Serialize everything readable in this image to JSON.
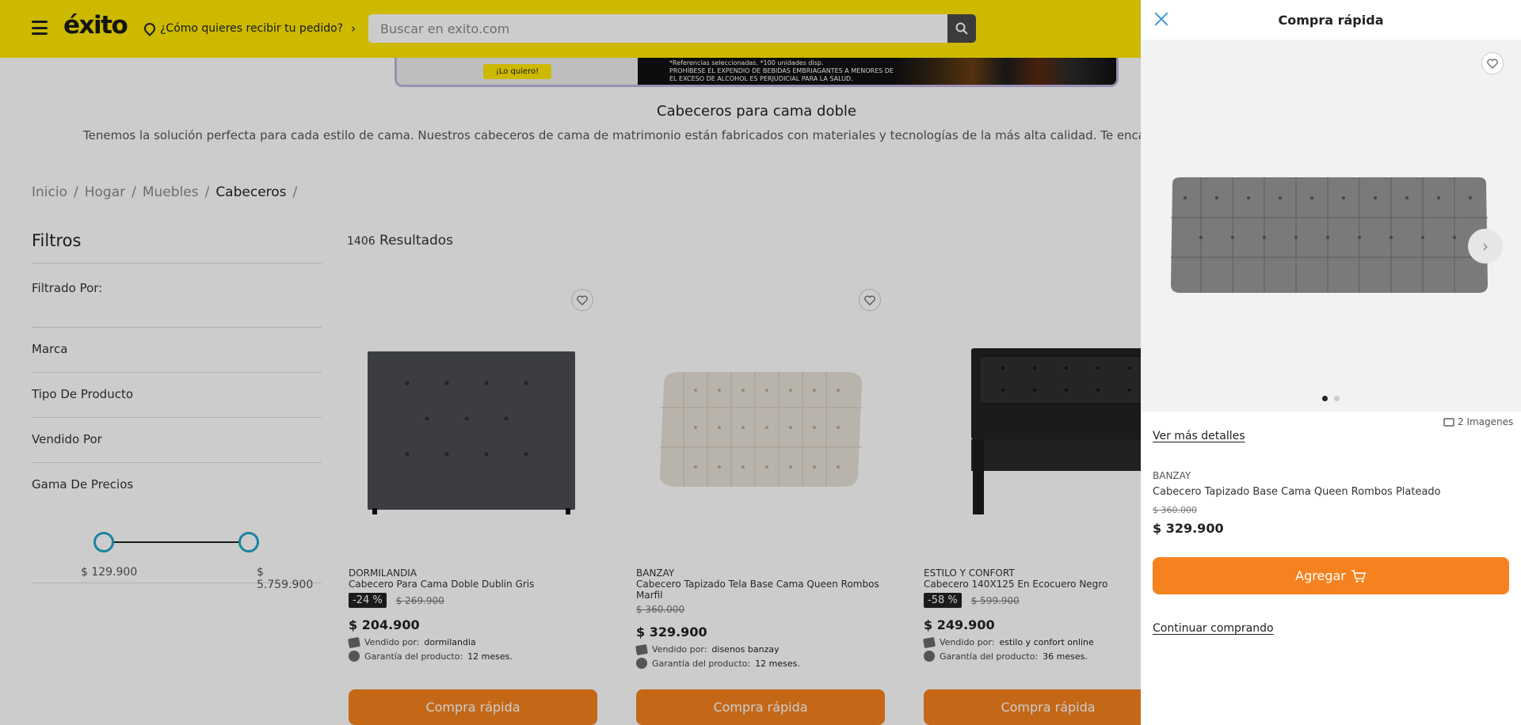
{
  "header": {
    "logo": "éxito",
    "delivery_text": "¿Cómo quieres recibir tu pedido?",
    "search_placeholder": "Buscar en exito.com"
  },
  "banner": {
    "button_label": "¡Lo quiero!",
    "legal_line1": "*Referencias seleccionadas. *100 unidades disp.",
    "legal_line2": "PROHÍBESE EL EXPENDIO DE BEBIDAS EMBRIAGANTES A MENORES DE EDAD,",
    "legal_line3": "EL EXCESO DE ALCOHOL ES PERJUDICIAL PARA LA SALUD."
  },
  "category": {
    "title": "Cabeceros para cama doble",
    "description": "Tenemos la solución perfecta para cada estilo de cama. Nuestros cabeceros de cama de matrimonio están fabricados con materiales y tecnologías de la más alta calidad. Te encantar"
  },
  "breadcrumb": {
    "items": [
      "Inicio",
      "Hogar",
      "Muebles"
    ],
    "current": "Cabeceros",
    "separator": "/"
  },
  "filters": {
    "title": "Filtros",
    "filtered_by": "Filtrado Por:",
    "groups": [
      "Marca",
      "Tipo De Producto",
      "Vendido Por",
      "Gama De Precios"
    ],
    "price_min": "$ 129.900",
    "price_max": "$ 5.759.900"
  },
  "results": {
    "count": "1406",
    "label": "Resultados"
  },
  "products": [
    {
      "brand": "DORMILANDIA",
      "name": "Cabecero Para Cama Doble Dublin Gris",
      "discount": "-24 %",
      "old_price": "$ 269.900",
      "price": "$ 204.900",
      "sold_by_label": "Vendido por:",
      "sold_by": "dormilandia",
      "warranty_label": "Garantía del producto:",
      "warranty": "12 meses.",
      "cta": "Compra rápida"
    },
    {
      "brand": "BANZAY",
      "name": "Cabecero Tapizado Tela Base Cama Queen Rombos Marfil",
      "discount": "",
      "old_price": "$ 360.000",
      "price": "$ 329.900",
      "sold_by_label": "Vendido por:",
      "sold_by": "disenos banzay",
      "warranty_label": "Garantía del producto:",
      "warranty": "12 meses.",
      "cta": "Compra rápida"
    },
    {
      "brand": "ESTILO Y CONFORT",
      "name": "Cabecero 140X125 En Ecocuero Negro",
      "discount": "-58 %",
      "old_price": "$ 599.900",
      "price": "$ 249.900",
      "sold_by_label": "Vendido por:",
      "sold_by": "estilo y confort online",
      "warranty_label": "Garantía del producto:",
      "warranty": "36 meses.",
      "cta": "Compra rápida"
    }
  ],
  "quick_buy": {
    "title": "Compra rápida",
    "image_count": "2 Imagenes",
    "more_details": "Ver más detalles",
    "brand": "BANZAY",
    "name": "Cabecero Tapizado Base Cama Queen Rombos Plateado",
    "old_price": "$ 360.000",
    "price": "$ 329.900",
    "add_label": "Agregar",
    "continue_label": "Continuar comprando"
  },
  "colors": {
    "brand_yellow": "#ffe800",
    "cta_orange": "#f5821f",
    "close_blue": "#3e9ad8",
    "slider_blue": "#1ea6c8"
  }
}
